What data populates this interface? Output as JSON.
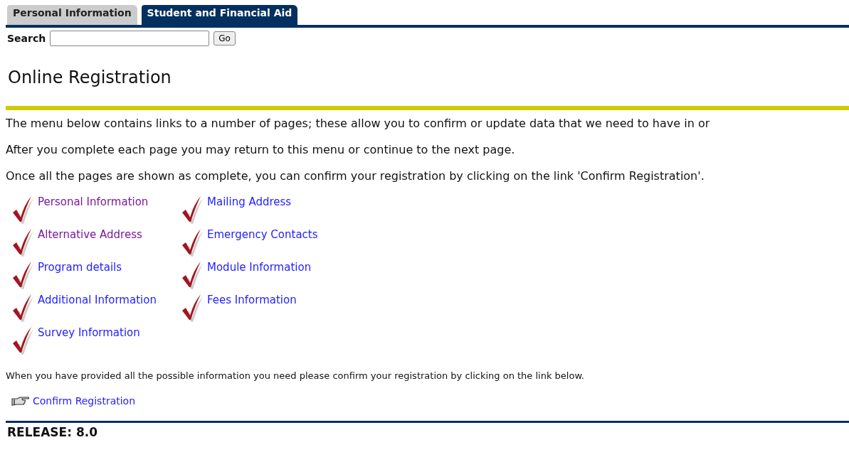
{
  "tabs": [
    {
      "label": "Personal Information",
      "selected": false
    },
    {
      "label": "Student and Financial Aid",
      "selected": true
    }
  ],
  "search": {
    "label": "Search",
    "button": "Go"
  },
  "title": "Online Registration",
  "paragraphs": [
    "The menu below contains links to a number of pages; these allow you to confirm or update data that we need to have in or",
    "After you complete each page you may return to this menu or continue to the next page.",
    "Once all the pages are shown as complete, you can confirm your registration by clicking on the link 'Confirm Registration'."
  ],
  "menu": [
    {
      "label": "Personal Information",
      "complete": true,
      "visited": true
    },
    {
      "label": "Mailing Address",
      "complete": true,
      "visited": false
    },
    {
      "label": "Alternative Address",
      "complete": true,
      "visited": true
    },
    {
      "label": "Emergency Contacts",
      "complete": true,
      "visited": false
    },
    {
      "label": "Program details",
      "complete": true,
      "visited": false
    },
    {
      "label": "Module Information",
      "complete": true,
      "visited": false
    },
    {
      "label": "Additional Information",
      "complete": true,
      "visited": false
    },
    {
      "label": "Fees Information",
      "complete": true,
      "visited": false
    },
    {
      "label": "Survey Information",
      "complete": true,
      "visited": false
    }
  ],
  "confirm_note": "When you have provided all the possible information you need please confirm your registration by clicking on the link below.",
  "confirm_link": "Confirm Registration",
  "release": "RELEASE: 8.0"
}
